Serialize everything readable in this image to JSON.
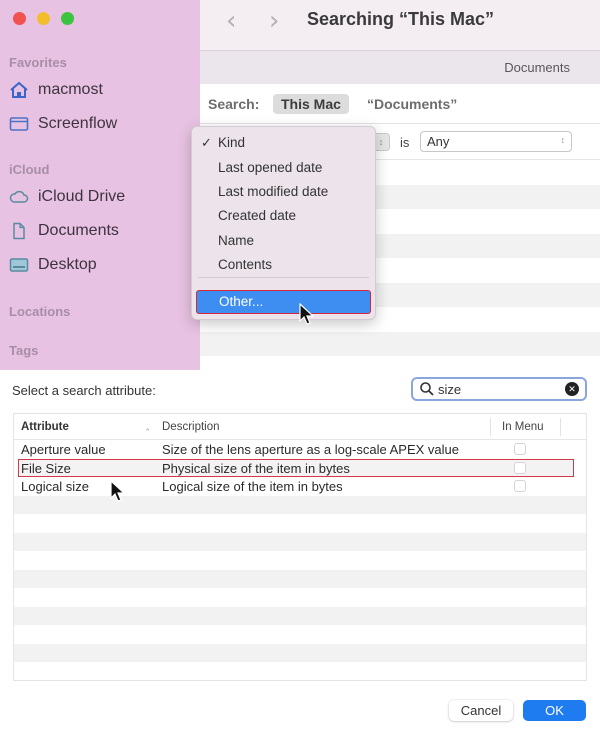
{
  "finder": {
    "window_title": "Searching “This Mac”",
    "nav": {
      "back_icon": "chevron-left-icon",
      "forward_icon": "chevron-right-icon"
    },
    "path_bar_label": "Documents",
    "sidebar": {
      "sections": [
        {
          "title": "Favorites",
          "items": [
            {
              "label": "macmost",
              "icon": "home-icon"
            },
            {
              "label": "Screenflow",
              "icon": "folder-icon"
            }
          ]
        },
        {
          "title": "iCloud",
          "items": [
            {
              "label": "iCloud Drive",
              "icon": "cloud-icon"
            },
            {
              "label": "Documents",
              "icon": "document-icon"
            },
            {
              "label": "Desktop",
              "icon": "desktop-icon"
            }
          ]
        },
        {
          "title": "Locations",
          "items": []
        },
        {
          "title": "Tags",
          "items": []
        }
      ]
    },
    "scope": {
      "label": "Search:",
      "options": [
        "This Mac",
        "“Documents”"
      ],
      "selected": "This Mac"
    },
    "criteria": {
      "operator": "is",
      "value": "Any"
    },
    "attribute_menu": {
      "items": [
        "Kind",
        "Last opened date",
        "Last modified date",
        "Created date",
        "Name",
        "Contents"
      ],
      "checked": "Kind",
      "other_item": "Other...",
      "highlighted": "Other..."
    }
  },
  "dialog": {
    "prompt": "Select a search attribute:",
    "search": {
      "value": "size",
      "placeholder": ""
    },
    "columns": {
      "attribute": "Attribute",
      "description": "Description",
      "in_menu": "In Menu"
    },
    "rows": [
      {
        "attribute": "Aperture value",
        "description": "Size of the lens aperture as a log-scale APEX value",
        "in_menu": false
      },
      {
        "attribute": "File Size",
        "description": "Physical size of the item in bytes",
        "in_menu": false,
        "highlighted": true
      },
      {
        "attribute": "Logical size",
        "description": "Logical size of the item in bytes",
        "in_menu": false
      }
    ],
    "buttons": {
      "cancel": "Cancel",
      "ok": "OK"
    }
  }
}
